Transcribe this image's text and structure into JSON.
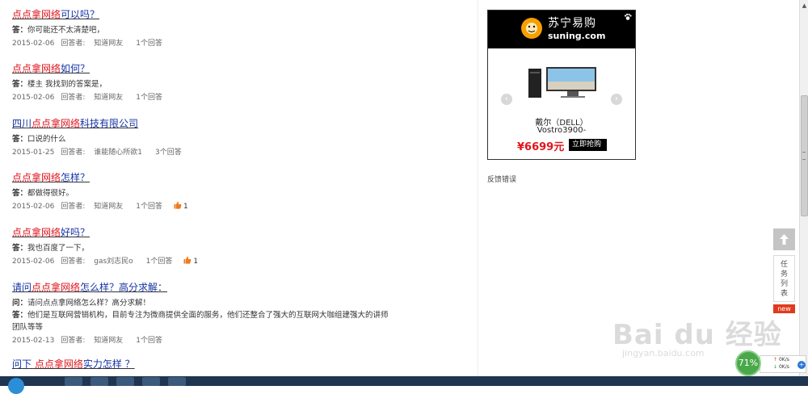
{
  "labels": {
    "answer_prefix": "答：",
    "question_prefix": "问：",
    "answerer_prefix": "回答者:"
  },
  "qa_items": [
    {
      "title_parts": [
        {
          "text": "点点拿网络",
          "highlight": true
        },
        {
          "text": "可以吗？",
          "highlight": false
        }
      ],
      "answer": "你可能还不太清楚吧，",
      "date": "2015-02-06",
      "answerer": "知道网友",
      "replies": "1个回答",
      "likes": ""
    },
    {
      "title_parts": [
        {
          "text": "点点拿网络",
          "highlight": true
        },
        {
          "text": "如何？",
          "highlight": false
        }
      ],
      "answer": "楼主 我找到的答案是，",
      "date": "2015-02-06",
      "answerer": "知道网友",
      "replies": "1个回答",
      "likes": ""
    },
    {
      "title_parts": [
        {
          "text": "四川",
          "highlight": false
        },
        {
          "text": "点点拿网络",
          "highlight": true
        },
        {
          "text": "科技有限公司",
          "highlight": false
        }
      ],
      "answer": "口说的什么",
      "date": "2015-01-25",
      "answerer": "谁能随心所欲1",
      "replies": "3个回答",
      "likes": ""
    },
    {
      "title_parts": [
        {
          "text": "点点拿网络",
          "highlight": true
        },
        {
          "text": "怎样？",
          "highlight": false
        }
      ],
      "answer": "都做得很好。",
      "date": "2015-02-06",
      "answerer": "知道网友",
      "replies": "1个回答",
      "likes": "1"
    },
    {
      "title_parts": [
        {
          "text": "点点拿网络",
          "highlight": true
        },
        {
          "text": "好吗？",
          "highlight": false
        }
      ],
      "answer": "我也百度了一下，",
      "date": "2015-02-06",
      "answerer": "gas刘志民o",
      "replies": "1个回答",
      "likes": "1"
    },
    {
      "title_parts": [
        {
          "text": "请问",
          "highlight": false
        },
        {
          "text": "点点拿网络",
          "highlight": true
        },
        {
          "text": "怎么样？高分求解：",
          "highlight": false
        }
      ],
      "question": "请问点点拿网络怎么样？高分求解！",
      "answer": "他们是互联网营销机构，目前专注为微商提供全面的服务，他们还整合了强大的互联网大咖组建强大的讲师团队等等",
      "date": "2015-02-13",
      "answerer": "知道网友",
      "replies": "1个回答",
      "likes": ""
    },
    {
      "title_parts": [
        {
          "text": "问下 ",
          "highlight": false
        },
        {
          "text": "点点拿网络",
          "highlight": true
        },
        {
          "text": "实力怎样 ？",
          "highlight": false
        }
      ]
    }
  ],
  "ad": {
    "logo_cn": "苏宁易购",
    "logo_en": "suning.com",
    "product_brand": "戴尔（DELL）",
    "product_model": "Vostro3900-",
    "price": "¥6699元",
    "buy_label": "立即抢购",
    "prev_arrow": "‹",
    "next_arrow": "›"
  },
  "feedback_label": "反馈错误",
  "side_tools": {
    "back_to_top_arrow": "▲",
    "task_list_chars": [
      "任",
      "务",
      "列",
      "表"
    ],
    "new_badge": "new"
  },
  "watermark": {
    "main": "Bai du 经验",
    "url": "jingyan.baidu.com"
  },
  "speed_widget": {
    "percent": "71%",
    "up": "0K/s",
    "down": "0K/s",
    "plus": "+"
  },
  "scrollbar": {
    "up_arrow": "▲"
  },
  "colors": {
    "highlight": "#e0161d",
    "link": "#1433a4",
    "ad_header_bg": "#000000",
    "suning_orange": "#f5a000",
    "like_orange": "#f07a1e",
    "new_badge": "#e03a1e"
  }
}
